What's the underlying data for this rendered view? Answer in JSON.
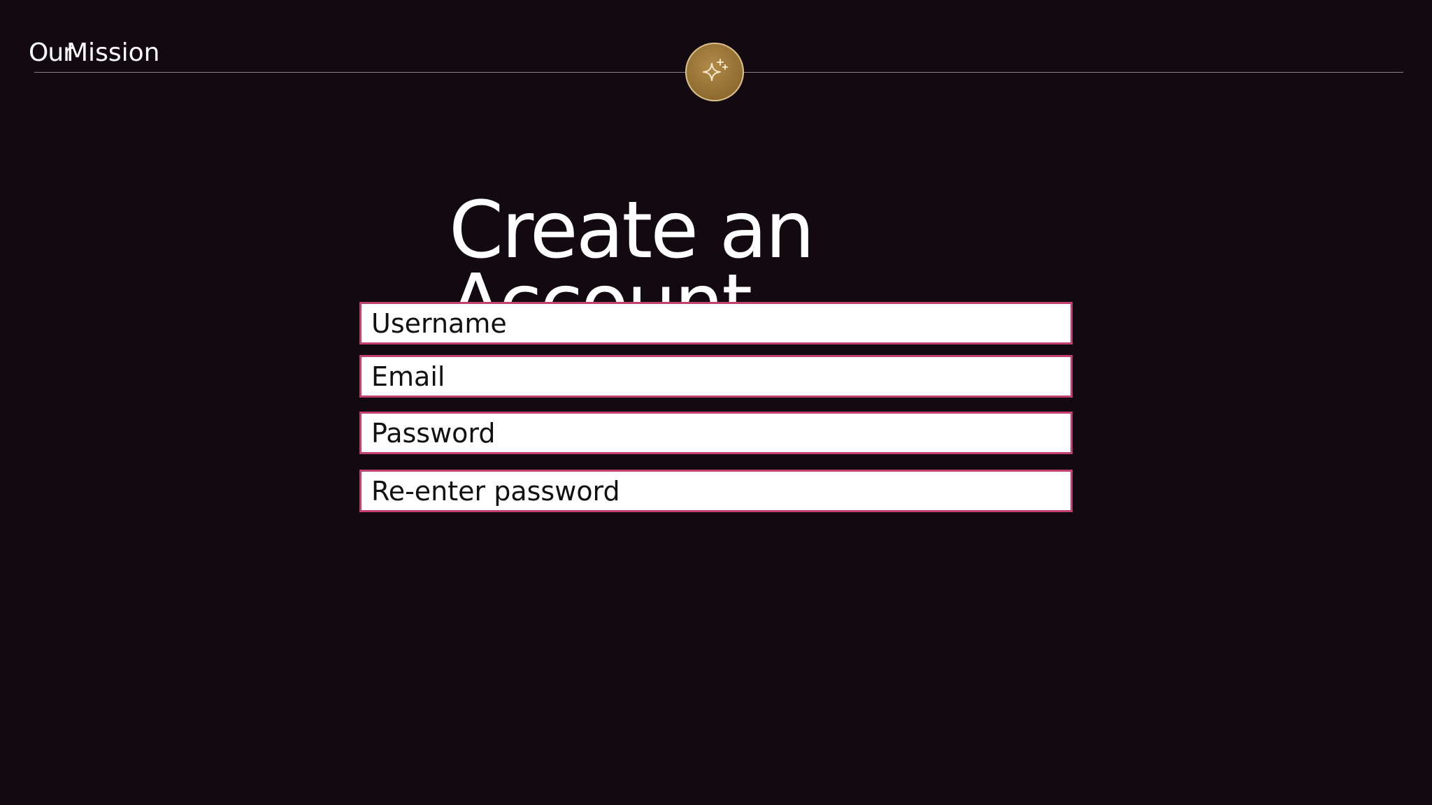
{
  "header": {
    "brand_word_1": "Our",
    "brand_word_2": "Mission"
  },
  "badge": {
    "icon": "sparkle-icon",
    "color": "#9a7438"
  },
  "main": {
    "title": "Create an Account",
    "fields": {
      "username_placeholder": "Username",
      "email_placeholder": "Email",
      "password_placeholder": "Password",
      "reenter_password_placeholder": "Re-enter password"
    }
  },
  "colors": {
    "background": "#130911",
    "field_border": "#c2406e",
    "text": "#ffffff"
  }
}
